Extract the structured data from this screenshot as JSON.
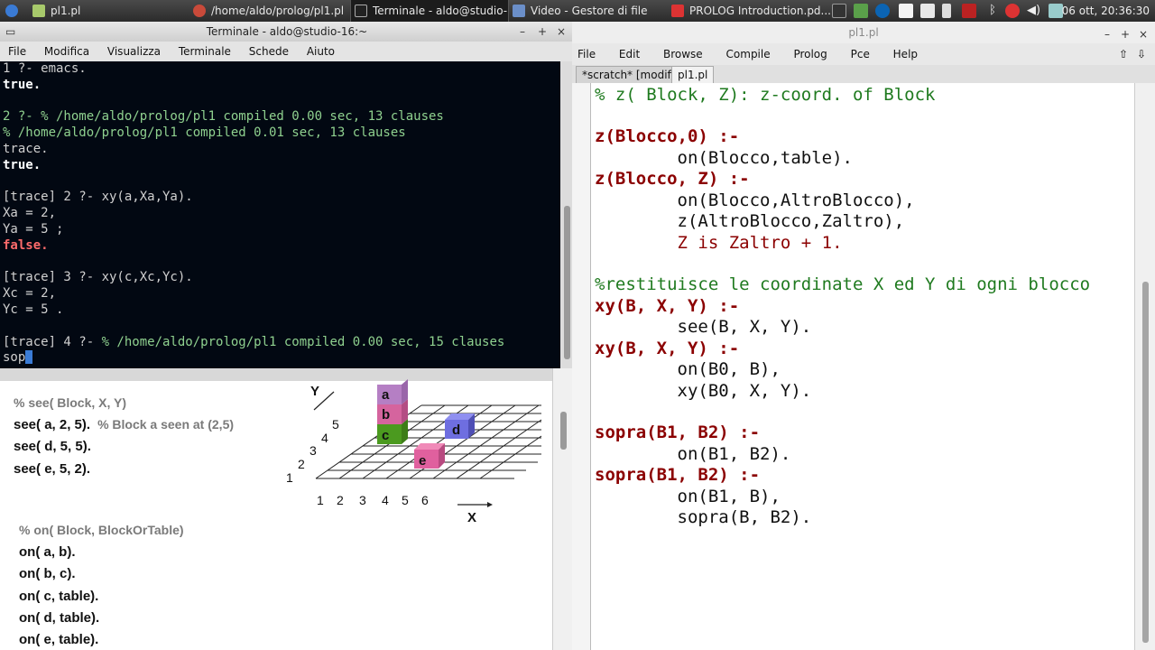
{
  "taskbar": {
    "items": [
      {
        "label": "pl1.pl"
      },
      {
        "label": "/home/aldo/prolog/pl1.pl"
      },
      {
        "label": "Terminale - aldo@studio-..."
      },
      {
        "label": "Video - Gestore di file"
      },
      {
        "label": "PROLOG Introduction.pd..."
      }
    ],
    "clock": "06 ott, 20:36:30"
  },
  "terminal": {
    "title": "Terminale - aldo@studio-16:~",
    "menu": [
      "File",
      "Modifica",
      "Visualizza",
      "Terminale",
      "Schede",
      "Aiuto"
    ],
    "lines": [
      "1 ?- emacs.",
      "true.",
      "",
      "2 ?- % /home/aldo/prolog/pl1 compiled 0.00 sec, 13 clauses",
      "% /home/aldo/prolog/pl1 compiled 0.01 sec, 13 clauses",
      "trace.",
      "true.",
      "",
      "[trace] 2 ?- xy(a,Xa,Ya).",
      "Xa = 2,",
      "Ya = 5 ;",
      "false.",
      "",
      "[trace] 3 ?- xy(c,Xc,Yc).",
      "Xc = 2,",
      "Yc = 5 .",
      "",
      "[trace] 4 ?- ",
      "% /home/aldo/prolog/pl1 compiled 0.00 sec, 15 clauses",
      "sop"
    ]
  },
  "slide": {
    "see_comment": "% see( Block, X, Y)",
    "see_facts": [
      "see( a, 2, 5).",
      "see( d, 5, 5).",
      "see( e, 5, 2)."
    ],
    "see_note": "% Block a seen at (2,5)",
    "on_comment": "% on( Block, BlockOrTable)",
    "on_facts": [
      "on( a, b).",
      "on( b, c).",
      "on( c, table).",
      "on( d, table).",
      "on( e, table)."
    ],
    "diagram": {
      "y_label": "Y",
      "x_label": "X",
      "y_ticks": [
        "1",
        "2",
        "3",
        "4",
        "5"
      ],
      "x_ticks": [
        "1",
        "2",
        "3",
        "4",
        "5",
        "6"
      ],
      "blocks": [
        {
          "label": "a",
          "color": "#b57fc4"
        },
        {
          "label": "b",
          "color": "#d5649e"
        },
        {
          "label": "c",
          "color": "#4b9a1f"
        },
        {
          "label": "d",
          "color": "#6e6ee0"
        },
        {
          "label": "e",
          "color": "#e0609e"
        }
      ]
    }
  },
  "editor": {
    "title": "pl1.pl",
    "menu": [
      "File",
      "Edit",
      "Browse",
      "Compile",
      "Prolog",
      "Pce",
      "Help"
    ],
    "tabs": [
      "*scratch* [modified]",
      "pl1.pl"
    ],
    "code": [
      "% z( Block, Z): z-coord. of Block",
      "",
      "z(Blocco,0) :-",
      "        on(Blocco,table).",
      "z(Blocco, Z) :-",
      "        on(Blocco,AltroBlocco),",
      "        z(AltroBlocco,Zaltro),",
      "        Z is Zaltro + 1.",
      "",
      "%restituisce le coordinate X ed Y di ogni blocco",
      "xy(B, X, Y) :-",
      "        see(B, X, Y).",
      "xy(B, X, Y) :-",
      "        on(B0, B),",
      "        xy(B0, X, Y).",
      "",
      "sopra(B1, B2) :-",
      "        on(B1, B2).",
      "sopra(B1, B2) :-",
      "        on(B1, B),",
      "        sopra(B, B2)."
    ]
  }
}
